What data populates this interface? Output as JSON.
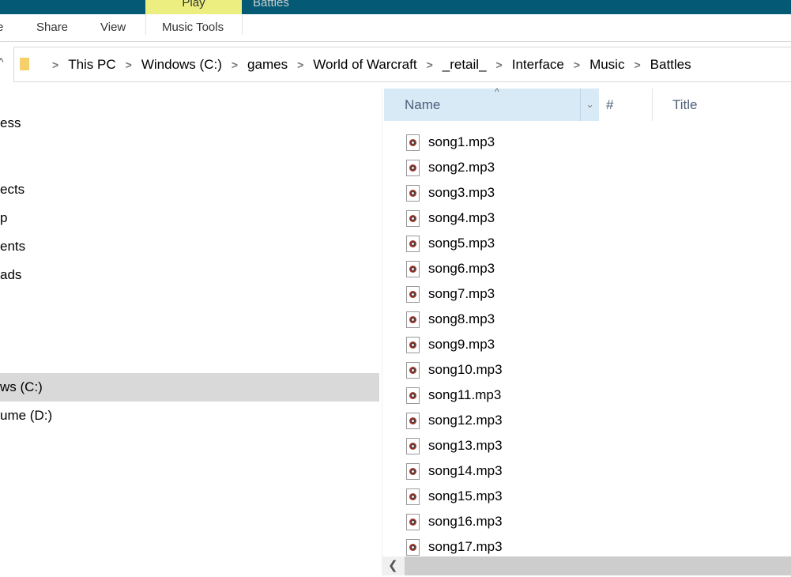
{
  "window": {
    "context_tab": "Play",
    "title": "Battles"
  },
  "ribbon": {
    "tabs": [
      "e",
      "Share",
      "View",
      "Music Tools"
    ]
  },
  "address": {
    "crumbs": [
      "This PC",
      "Windows (C:)",
      "games",
      "World of Warcraft",
      "_retail_",
      "Interface",
      "Music",
      "Battles"
    ]
  },
  "nav": {
    "items": [
      {
        "label": "ess",
        "selected": false
      },
      {
        "label": "ects",
        "selected": false
      },
      {
        "label": "p",
        "selected": false
      },
      {
        "label": "ents",
        "selected": false
      },
      {
        "label": "ads",
        "selected": false
      },
      {
        "label": "ws (C:)",
        "selected": true
      },
      {
        "label": "ume (D:)",
        "selected": false
      }
    ]
  },
  "columns": {
    "name": "Name",
    "number": "#",
    "title": "Title"
  },
  "files": [
    "song1.mp3",
    "song2.mp3",
    "song3.mp3",
    "song4.mp3",
    "song5.mp3",
    "song6.mp3",
    "song7.mp3",
    "song8.mp3",
    "song9.mp3",
    "song10.mp3",
    "song11.mp3",
    "song12.mp3",
    "song13.mp3",
    "song14.mp3",
    "song15.mp3",
    "song16.mp3",
    "song17.mp3"
  ],
  "colors": {
    "titlebar": "#045a74",
    "context_tab": "#ecef80",
    "selected_column": "#d9eaf7",
    "selected_nav": "#d9d9d9"
  }
}
